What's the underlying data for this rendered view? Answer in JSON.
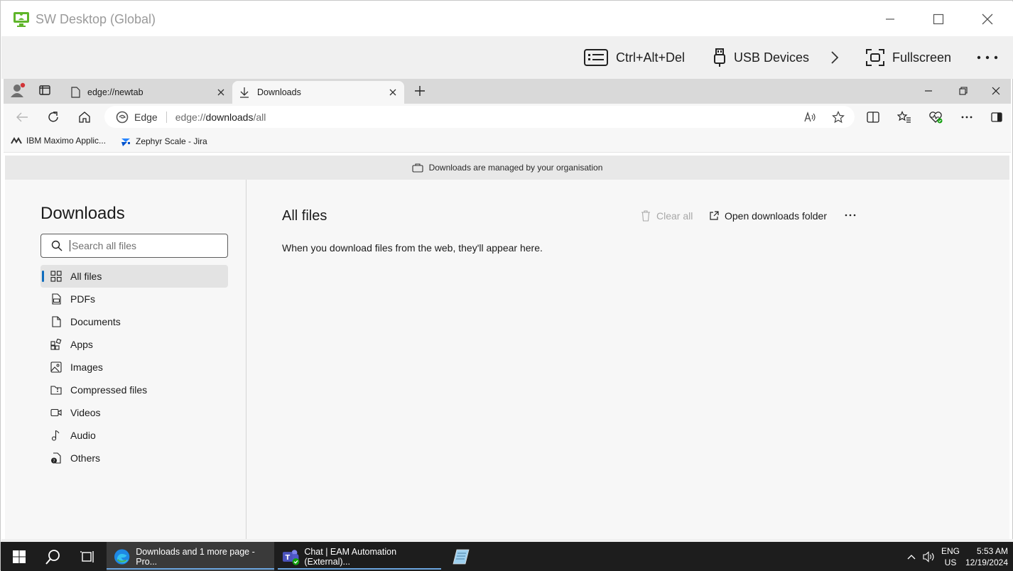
{
  "remote": {
    "title": "SW Desktop (Global)",
    "ctrl_alt_del": "Ctrl+Alt+Del",
    "usb_devices": "USB Devices",
    "fullscreen": "Fullscreen"
  },
  "browser": {
    "tabs": [
      {
        "label": "edge://newtab"
      },
      {
        "label": "Downloads"
      }
    ],
    "omnibox": {
      "site_label": "Edge",
      "url_prefix": "edge://",
      "url_host": "downloads",
      "url_path": "/all"
    },
    "favorites": [
      {
        "label": "IBM Maximo Applic..."
      },
      {
        "label": "Zephyr Scale - Jira"
      }
    ],
    "managed_notice": "Downloads are managed by your organisation"
  },
  "downloads": {
    "title": "Downloads",
    "search_placeholder": "Search all files",
    "categories": [
      {
        "label": "All files",
        "icon": "grid-icon"
      },
      {
        "label": "PDFs",
        "icon": "pdf-icon"
      },
      {
        "label": "Documents",
        "icon": "document-icon"
      },
      {
        "label": "Apps",
        "icon": "apps-icon"
      },
      {
        "label": "Images",
        "icon": "image-icon"
      },
      {
        "label": "Compressed files",
        "icon": "archive-icon"
      },
      {
        "label": "Videos",
        "icon": "video-icon"
      },
      {
        "label": "Audio",
        "icon": "audio-icon"
      },
      {
        "label": "Others",
        "icon": "other-file-icon"
      }
    ],
    "selected_category": "All files",
    "main_title": "All files",
    "clear_all": "Clear all",
    "open_folder": "Open downloads folder",
    "empty_message": "When you download files from the web, they'll appear here."
  },
  "taskbar": {
    "apps": [
      {
        "label": "Downloads and 1 more page - Pro..."
      },
      {
        "label": "Chat | EAM Automation (External)..."
      }
    ],
    "lang_top": "ENG",
    "lang_bottom": "US",
    "time": "5:53 AM",
    "date": "12/19/2024"
  },
  "colors": {
    "accent": "#0f6cbd",
    "logo_green": "#5fb52a",
    "taskbar": "#1d1d1d"
  }
}
